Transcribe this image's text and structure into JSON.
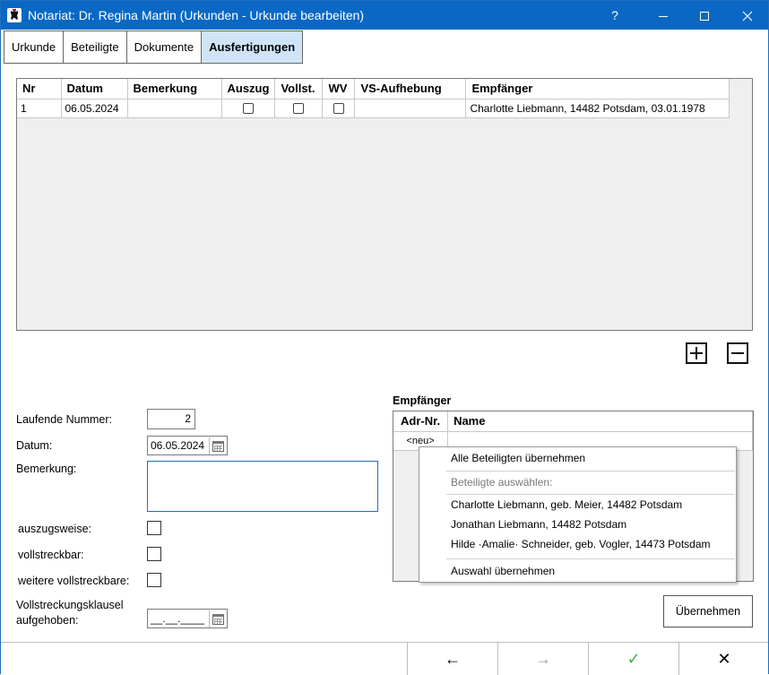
{
  "window": {
    "title": "Notariat: Dr. Regina Martin (Urkunden - Urkunde bearbeiten)",
    "help_label": "?",
    "minimize_label": "—",
    "maximize_label": "☐",
    "close_label": "✕"
  },
  "tabs": [
    {
      "label": "Urkunde"
    },
    {
      "label": "Beteiligte"
    },
    {
      "label": "Dokumente"
    },
    {
      "label": "Ausfertigungen",
      "active": true
    }
  ],
  "grid": {
    "columns": [
      "Nr",
      "Datum",
      "Bemerkung",
      "Auszug",
      "Vollst.",
      "WV",
      "VS-Aufhebung",
      "Empfänger"
    ],
    "rows": [
      {
        "nr": "1",
        "datum": "06.05.2024",
        "bemerkung": "",
        "auszug": false,
        "vollst": false,
        "wv": false,
        "vs_aufhebung": "",
        "empfaenger": "Charlotte Liebmann, 14482 Potsdam, 03.01.1978"
      }
    ]
  },
  "form": {
    "laufende_nummer_label": "Laufende Nummer:",
    "laufende_nummer_value": "2",
    "datum_label": "Datum:",
    "datum_value": "06.05.2024",
    "bemerkung_label": "Bemerkung:",
    "bemerkung_value": "",
    "auszugsweise_label": "auszugsweise:",
    "auszugsweise_checked": false,
    "vollstreckbar_label": "vollstreckbar:",
    "vollstreckbar_checked": false,
    "weitere_label": "weitere vollstreckbare:",
    "weitere_checked": false,
    "klausel_label_1": "Vollstreckungsklausel",
    "klausel_label_2": "aufgehoben:",
    "klausel_value": "__.__.____"
  },
  "empfaenger": {
    "heading": "Empfänger",
    "col_adr": "Adr-Nr.",
    "col_name": "Name",
    "new_row_label": "<neu>"
  },
  "context_menu": {
    "item_all": "Alle Beteiligten übernehmen",
    "header_select": "Beteiligte auswählen:",
    "persons": [
      "Charlotte Liebmann, geb. Meier, 14482 Potsdam",
      "Jonathan Liebmann, 14482 Potsdam",
      "Hilde ·Amalie· Schneider, geb. Vogler, 14473 Potsdam"
    ],
    "item_apply": "Auswahl übernehmen"
  },
  "buttons": {
    "uebernehmen": "Übernehmen"
  },
  "nav": {
    "back": "←",
    "forward": "→",
    "ok": "✓",
    "cancel": "✕"
  },
  "colors": {
    "titlebar": "#0a68c4",
    "active_tab": "#cfe4f7",
    "ok_green": "#4caf50",
    "focus_border": "#1f6fc0"
  }
}
